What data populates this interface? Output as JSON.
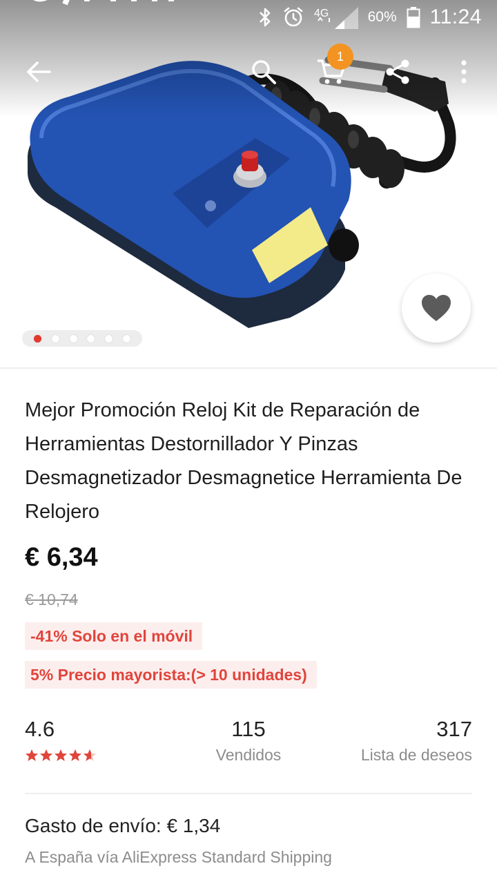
{
  "status_bar": {
    "network": "4G",
    "battery": "60%",
    "time": "11:24",
    "icons": [
      "bluetooth-icon",
      "alarm-icon",
      "signal-icon",
      "battery-icon"
    ]
  },
  "toolbar": {
    "cart_count": "1",
    "icons": [
      "back-arrow-icon",
      "search-icon",
      "cart-icon",
      "share-icon",
      "more-vert-icon"
    ]
  },
  "gallery": {
    "image_count": 6,
    "active_index": 0
  },
  "product": {
    "title": "Mejor Promoción Reloj Kit de Reparación de Herramientas Destornillador Y Pinzas Desmagnetizador Desmagnetice Herramienta De Relojero",
    "price": "€ 6,34",
    "original_price": "€ 10,74",
    "mobile_discount": "-41% Solo en el móvil",
    "bulk_price": "5% Precio mayorista:(> 10 unidades)"
  },
  "stats": {
    "rating": "4.6",
    "rating_value": 4.6,
    "rating_max": 5,
    "sold_count": "115",
    "sold_label": "Vendidos",
    "wishlist_count": "317",
    "wishlist_label": "Lista de deseos"
  },
  "shipping": {
    "cost": "Gasto de envío: € 1,34",
    "route": "A España vía AliExpress Standard Shipping"
  },
  "colors": {
    "accent_red": "#e0453b",
    "tag_bg": "#fdeeee",
    "badge_orange": "#f39322",
    "product_blue": "#2353b3"
  }
}
